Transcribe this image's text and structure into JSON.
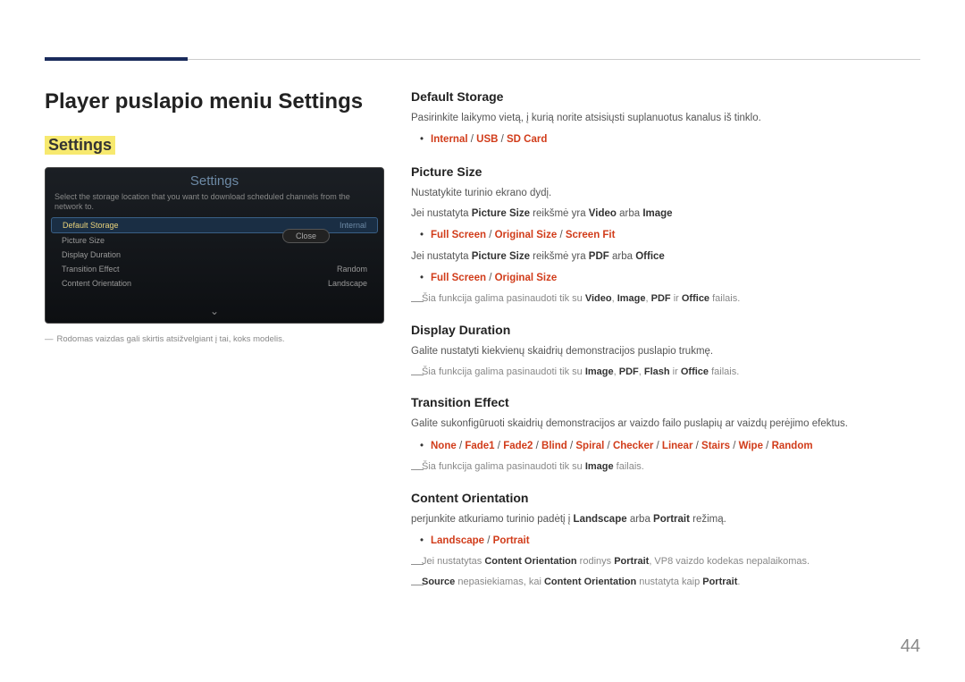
{
  "page": {
    "title": "Player puslapio meniu Settings",
    "number": "44"
  },
  "section": {
    "heading": "Settings"
  },
  "panel": {
    "title": "Settings",
    "desc": "Select the storage location that you want to download scheduled channels from the network to.",
    "rows": [
      {
        "label": "Default Storage",
        "value": "Internal"
      },
      {
        "label": "Picture Size",
        "value": ""
      },
      {
        "label": "Display Duration",
        "value": ""
      },
      {
        "label": "Transition Effect",
        "value": "Random"
      },
      {
        "label": "Content Orientation",
        "value": "Landscape"
      }
    ],
    "close": "Close"
  },
  "image_footnote": "Rodomas vaizdas gali skirtis atsižvelgiant į tai, koks modelis.",
  "right": {
    "defaultStorage": {
      "title": "Default Storage",
      "desc": "Pasirinkite laikymo vietą, į kurią norite atsisiųsti suplanuotus kanalus iš tinklo.",
      "opt_internal": "Internal",
      "opt_usb": "USB",
      "opt_sd": "SD Card"
    },
    "pictureSize": {
      "title": "Picture Size",
      "desc1": "Nustatykite turinio ekrano dydį.",
      "p2_pre": "Jei nustatyta ",
      "p2_ps": "Picture Size",
      "p2_mid": " reikšmė yra ",
      "p2_v": "Video",
      "p2_or": " arba ",
      "p2_i": "Image",
      "opt1_a": "Full Screen",
      "opt1_b": "Original Size",
      "opt1_c": "Screen Fit",
      "p3_pre": "Jei nustatyta ",
      "p3_ps": "Picture Size",
      "p3_mid": " reikšmė yra ",
      "p3_pdf": "PDF",
      "p3_or": " arba ",
      "p3_off": "Office",
      "opt2_a": "Full Screen",
      "opt2_b": "Original Size",
      "note_pre": "Šia funkcija galima pasinaudoti tik su ",
      "note_v": "Video",
      "note_c1": ", ",
      "note_i": "Image",
      "note_c2": ", ",
      "note_p": "PDF",
      "note_ir": " ir ",
      "note_o": "Office",
      "note_suf": " failais."
    },
    "displayDuration": {
      "title": "Display Duration",
      "desc": "Galite nustatyti kiekvienų skaidrių demonstracijos puslapio trukmę.",
      "note_pre": "Šia funkcija galima pasinaudoti tik su ",
      "n_i": "Image",
      "n_c1": ", ",
      "n_p": "PDF",
      "n_c2": ", ",
      "n_f": "Flash",
      "n_ir": " ir ",
      "n_o": "Office",
      "note_suf": " failais."
    },
    "transitionEffect": {
      "title": "Transition Effect",
      "desc": "Galite sukonfigūruoti skaidrių demonstracijos ar vaizdo failo puslapių ar vaizdų perėjimo efektus.",
      "o1": "None",
      "o2": "Fade1",
      "o3": "Fade2",
      "o4": "Blind",
      "o5": "Spiral",
      "o6": "Checker",
      "o7": "Linear",
      "o8": "Stairs",
      "o9": "Wipe",
      "o10": "Random",
      "note_pre": "Šia funkcija galima pasinaudoti tik su ",
      "n_i": "Image",
      "note_suf": " failais."
    },
    "contentOrientation": {
      "title": "Content Orientation",
      "d_pre": "perjunkite atkuriamo turinio padėtį į ",
      "d_l": "Landscape",
      "d_or": " arba ",
      "d_p": "Portrait",
      "d_suf": " režimą.",
      "opt_l": "Landscape",
      "opt_p": "Portrait",
      "n1_pre": "Jei nustatytas ",
      "n1_co": "Content Orientation",
      "n1_mid": " rodinys ",
      "n1_p": "Portrait",
      "n1_suf": ", VP8 vaizdo kodekas nepalaikomas.",
      "n2_s": "Source",
      "n2_mid1": " nepasiekiamas, kai ",
      "n2_co": "Content Orientation",
      "n2_mid2": " nustatyta kaip ",
      "n2_p": "Portrait",
      "n2_suf": "."
    }
  }
}
